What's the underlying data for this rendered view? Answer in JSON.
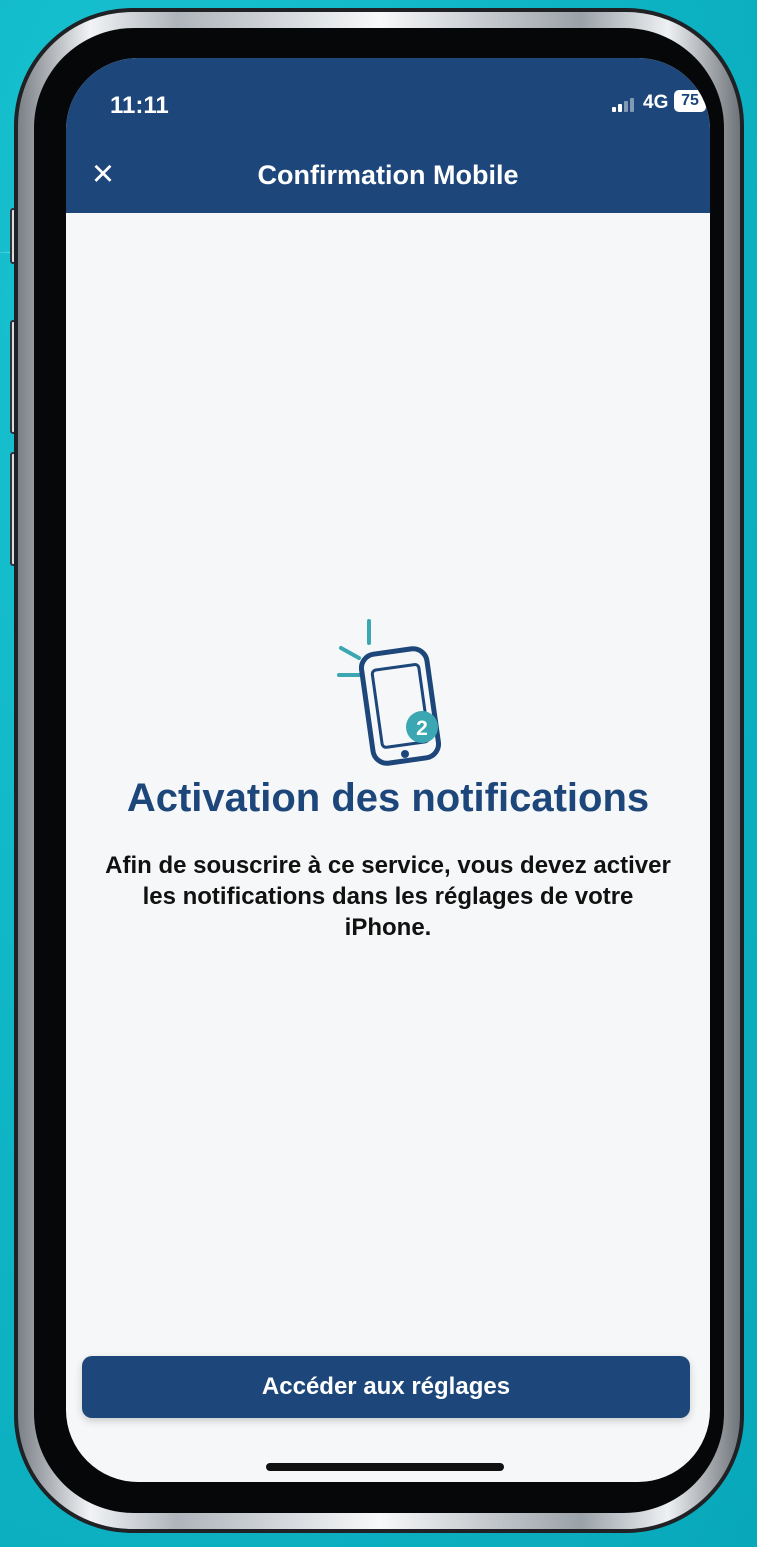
{
  "status": {
    "time": "11:11",
    "network": "4G",
    "battery": "75"
  },
  "header": {
    "title": "Confirmation Mobile"
  },
  "content": {
    "badge": "2",
    "heading": "Activation des notifications",
    "body": "Afin de souscrire à ce service, vous devez activer les notifications dans les réglages de votre iPhone."
  },
  "footer": {
    "button_label": "Accéder aux réglages"
  },
  "icons": {
    "close": "close-icon",
    "phone": "phone-notification-icon"
  },
  "colors": {
    "primary": "#1d467a",
    "accent": "#3aa7b2",
    "background": "#10b8c8",
    "surface": "#f6f7f8"
  }
}
